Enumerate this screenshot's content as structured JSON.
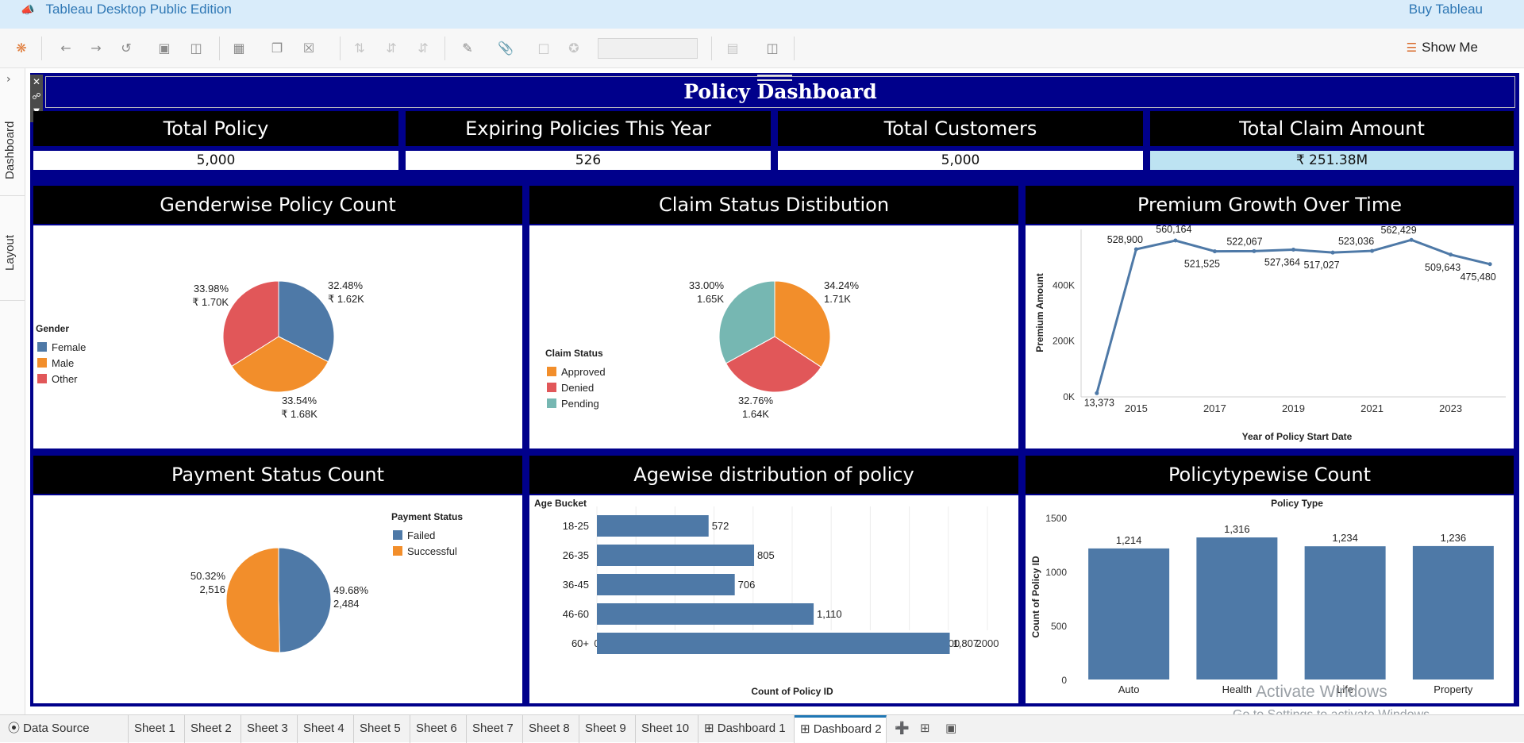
{
  "app": {
    "title": "Tableau Desktop Public Edition",
    "buy": "Buy Tableau"
  },
  "toolbar": {
    "show_me": "Show Me"
  },
  "left_rail": {
    "dashboard_tab": "Dashboard",
    "layout_tab": "Layout"
  },
  "dashboard": {
    "title": "Policy Dashboard",
    "kpis": [
      {
        "label": "Total Policy",
        "value": "5,000"
      },
      {
        "label": "Expiring Policies This Year",
        "value": "526"
      },
      {
        "label": "Total Customers",
        "value": "5,000"
      },
      {
        "label": "Total Claim Amount",
        "value": "₹ 251.38M"
      }
    ],
    "panels": {
      "gender": "Genderwise Policy Count",
      "claim": "Claim Status Distibution",
      "premium": "Premium Growth Over Time",
      "payment": "Payment Status Count",
      "age": "Agewise distribution of policy",
      "policytype": "Policytypewise Count"
    }
  },
  "colors": {
    "blue": "#4e79a7",
    "orange": "#f28e2b",
    "red": "#e15759",
    "teal": "#76b7b2",
    "navy": "#00008b",
    "kpi_highlight": "#bde3f2"
  },
  "chart_data": [
    {
      "id": "gender",
      "type": "pie",
      "legend_title": "Gender",
      "categories": [
        "Female",
        "Male",
        "Other"
      ],
      "values": [
        32.48,
        33.54,
        33.98
      ],
      "labels": [
        [
          "32.48%",
          "₹ 1.62K"
        ],
        [
          "33.54%",
          "₹ 1.68K"
        ],
        [
          "33.98%",
          "₹ 1.70K"
        ]
      ],
      "colors": [
        "#4e79a7",
        "#f28e2b",
        "#e15759"
      ]
    },
    {
      "id": "claim",
      "type": "pie",
      "legend_title": "Claim Status",
      "categories": [
        "Approved",
        "Denied",
        "Pending"
      ],
      "values": [
        34.24,
        32.76,
        33.0
      ],
      "labels": [
        [
          "34.24%",
          "1.71K"
        ],
        [
          "32.76%",
          "1.64K"
        ],
        [
          "33.00%",
          "1.65K"
        ]
      ],
      "colors": [
        "#f28e2b",
        "#e15759",
        "#76b7b2"
      ]
    },
    {
      "id": "premium",
      "type": "line",
      "x": [
        2014,
        2015,
        2016,
        2017,
        2018,
        2019,
        2020,
        2021,
        2022,
        2023,
        2024
      ],
      "values": [
        13373,
        528900,
        560164,
        521525,
        522067,
        527364,
        517027,
        523036,
        562429,
        509643,
        475480
      ],
      "value_labels": [
        "13,373",
        "528,900",
        "560,164",
        "521,525",
        "522,067",
        "527,364",
        "517,027",
        "523,036",
        "562,429",
        "509,643",
        "475,480"
      ],
      "xticks": [
        "2015",
        "2017",
        "2019",
        "2021",
        "2023"
      ],
      "yticks": [
        "0K",
        "200K",
        "400K"
      ],
      "ylim": [
        0,
        600000
      ],
      "xlabel": "Year of Policy Start Date",
      "ylabel": "Premium Amount"
    },
    {
      "id": "payment",
      "type": "pie",
      "legend_title": "Payment Status",
      "categories": [
        "Failed",
        "Successful"
      ],
      "values": [
        49.68,
        50.32
      ],
      "labels": [
        [
          "49.68%",
          "2,484"
        ],
        [
          "50.32%",
          "2,516"
        ]
      ],
      "colors": [
        "#4e79a7",
        "#f28e2b"
      ]
    },
    {
      "id": "age",
      "type": "bar",
      "orientation": "horizontal",
      "header": "Age Bucket",
      "categories": [
        "18-25",
        "26-35",
        "36-45",
        "46-60",
        "60+"
      ],
      "values": [
        572,
        805,
        706,
        1110,
        1807
      ],
      "value_labels": [
        "572",
        "805",
        "706",
        "1,110",
        "1,807"
      ],
      "xticks": [
        "0",
        "200",
        "400",
        "600",
        "800",
        "1000",
        "1200",
        "1400",
        "1600",
        "1800",
        "2000"
      ],
      "xlim": [
        0,
        2000
      ],
      "xlabel": "Count of Policy ID"
    },
    {
      "id": "policytype",
      "type": "bar",
      "header": "Policy Type",
      "categories": [
        "Auto",
        "Health",
        "Life",
        "Property"
      ],
      "values": [
        1214,
        1316,
        1234,
        1236
      ],
      "value_labels": [
        "1,214",
        "1,316",
        "1,234",
        "1,236"
      ],
      "yticks": [
        "0",
        "500",
        "1000",
        "1500"
      ],
      "ylim": [
        0,
        1600
      ],
      "ylabel": "Count of Policy ID"
    }
  ],
  "sheet_tabs": [
    "Data Source",
    "Sheet 1",
    "Sheet 2",
    "Sheet 3",
    "Sheet 4",
    "Sheet 5",
    "Sheet 6",
    "Sheet 7",
    "Sheet 8",
    "Sheet 9",
    "Sheet 10",
    "Dashboard 1",
    "Dashboard 2"
  ],
  "active_tab": "Dashboard 2",
  "watermark": {
    "line1": "Activate Windows",
    "line2": "Go to Settings to activate Windows."
  }
}
